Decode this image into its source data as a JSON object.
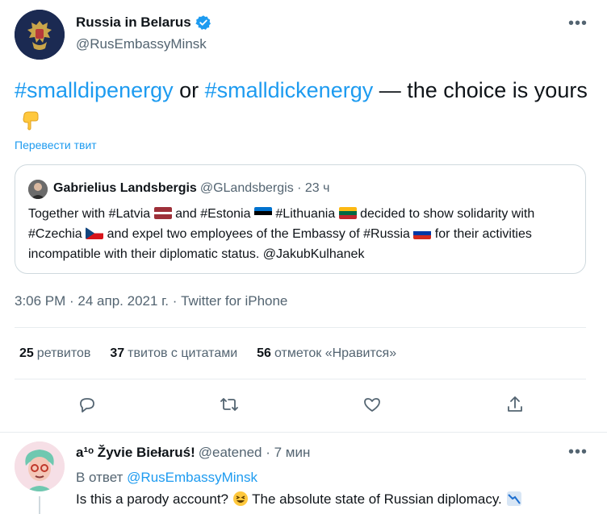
{
  "author": {
    "name": "Russia in Belarus",
    "handle": "@RusEmbassyMinsk"
  },
  "tweet": {
    "hashtag1": "#smalldipenergy",
    "or_text": " or ",
    "hashtag2": "#smalldickenergy",
    "rest_text": " — the choice is yours",
    "emoji": "pointing-down-emoji",
    "translate_label": "Перевести твит"
  },
  "quote": {
    "name": "Gabrielius Landsbergis",
    "handle_time": "@GLandsbergis · 23 ч",
    "text_1": "Together with #Latvia ",
    "text_2": " and #Estonia ",
    "text_3": " #Lithuania ",
    "text_4": " decided to show solidarity with #Czechia ",
    "text_5": " and expel two employees of the Embassy of #Russia ",
    "text_6": " for their activities incompatible with their diplomatic status. @JakubKulhanek",
    "flags": [
      "latvia-flag",
      "estonia-flag",
      "lithuania-flag",
      "czechia-flag",
      "russia-flag"
    ]
  },
  "timestamp": "3:06 PM · 24 апр. 2021 г. · Twitter for iPhone",
  "stats": {
    "retweets_count": "25",
    "retweets_label": "ретвитов",
    "quotes_count": "37",
    "quotes_label": "твитов с цитатами",
    "likes_count": "56",
    "likes_label": "отметок «Нравится»"
  },
  "actions": [
    "reply-icon",
    "retweet-icon",
    "like-icon",
    "share-icon"
  ],
  "more_label": "•••",
  "reply": {
    "name": "a¹ᵒ Žyvie Biełaruś!",
    "handle_time": "@eatened · 7 мин",
    "reply_to_prefix": "В ответ ",
    "reply_to_handle": "@RusEmbassyMinsk",
    "text_1": "Is this a parody account? ",
    "text_2": " The absolute state of Russian diplomacy. "
  },
  "colors": {
    "accent": "#1d9bf0",
    "secondary_text": "#536471",
    "border": "#cfd9de"
  }
}
